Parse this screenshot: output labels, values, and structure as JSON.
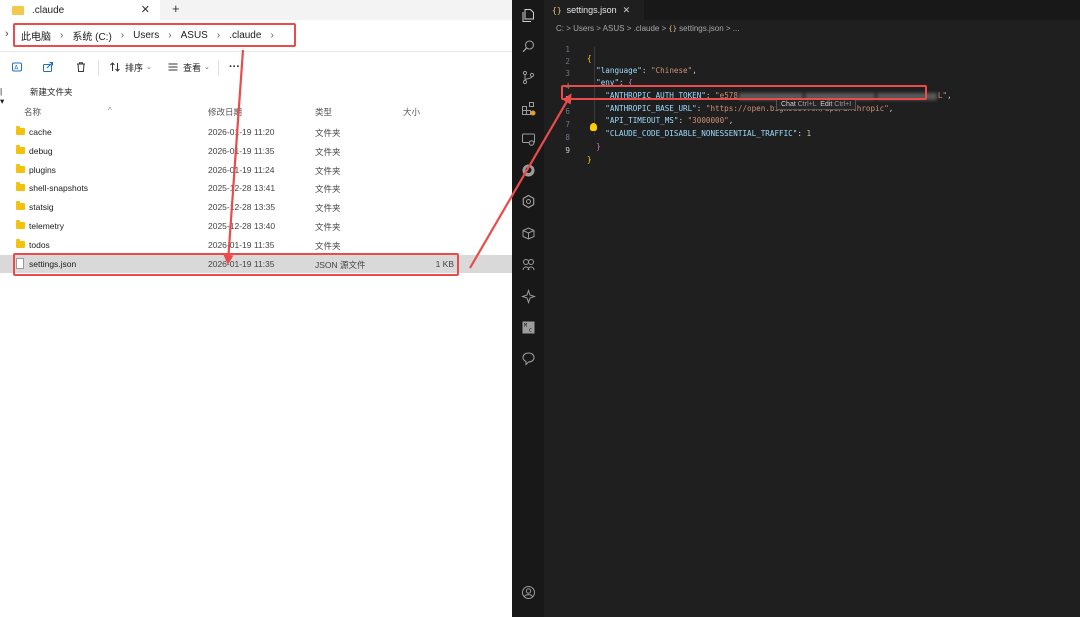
{
  "explorer": {
    "tab_title": ".claude",
    "tab_close": "✕",
    "new_tab": "+",
    "breadcrumb": [
      "此电脑",
      "系统 (C:)",
      "Users",
      "ASUS",
      ".claude"
    ],
    "toolbar": {
      "sort_label": "排序",
      "view_label": "查看",
      "more_label": "···"
    },
    "new_folder": "新建文件夹",
    "columns": {
      "name": "名称",
      "date": "修改日期",
      "type": "类型",
      "size": "大小"
    },
    "files": [
      {
        "name": "cache",
        "date": "2026-01-19 11:20",
        "type": "文件夹",
        "size": "",
        "kind": "folder"
      },
      {
        "name": "debug",
        "date": "2026-01-19 11:35",
        "type": "文件夹",
        "size": "",
        "kind": "folder"
      },
      {
        "name": "plugins",
        "date": "2026-01-19 11:24",
        "type": "文件夹",
        "size": "",
        "kind": "folder"
      },
      {
        "name": "shell-snapshots",
        "date": "2025-12-28 13:41",
        "type": "文件夹",
        "size": "",
        "kind": "folder"
      },
      {
        "name": "statsig",
        "date": "2025-12-28 13:35",
        "type": "文件夹",
        "size": "",
        "kind": "folder"
      },
      {
        "name": "telemetry",
        "date": "2025-12-28 13:40",
        "type": "文件夹",
        "size": "",
        "kind": "folder"
      },
      {
        "name": "todos",
        "date": "2026-01-19 11:35",
        "type": "文件夹",
        "size": "",
        "kind": "folder"
      },
      {
        "name": "settings.json",
        "date": "2026-01-19 11:35",
        "type": "JSON 源文件",
        "size": "1 KB",
        "kind": "file"
      }
    ]
  },
  "vscode": {
    "tab_title": "settings.json",
    "tab_close": "✕",
    "tab_icon": "{}",
    "breadcrumb_text": "C: > Users > ASUS > .claude > ",
    "breadcrumb_file": "settings.json > ...",
    "lines": [
      {
        "n": "1",
        "html_key": "l1"
      },
      {
        "n": "2",
        "html_key": "l2"
      },
      {
        "n": "3",
        "html_key": "l3"
      },
      {
        "n": "4",
        "html_key": "l4"
      },
      {
        "n": "5",
        "html_key": "l5"
      },
      {
        "n": "6",
        "html_key": "l6"
      },
      {
        "n": "7",
        "html_key": "l7"
      },
      {
        "n": "8",
        "html_key": "l8"
      },
      {
        "n": "9",
        "html_key": "l9"
      }
    ],
    "code": {
      "k_language": "\"language\"",
      "v_language": "\"Chinese\"",
      "k_env": "\"env\"",
      "k_token": "\"ANTHROPIC_AUTH_TOKEN\"",
      "v_token_start": "\"e578",
      "v_token_end": "L\"",
      "k_base_url": "\"ANTHROPIC_BASE_URL\"",
      "v_base_url": "\"https://open.bigmodel.cn/api/anthropic\"",
      "k_timeout": "\"API_TIMEOUT_MS\"",
      "v_timeout": "\"3000000\"",
      "k_nonessential": "\"CLAUDE_CODE_DISABLE_NONESSENTIAL_TRAFFIC\"",
      "v_nonessential": "1"
    },
    "inline_hint": {
      "chat": "Chat",
      "chat_kb": "Ctrl+L",
      "edit": "Edit",
      "edit_kb": "Ctrl+I"
    }
  },
  "colors": {
    "annotation_red": "#ea4b4b",
    "vscode_bg": "#1f1f1f",
    "json_key": "#9cdcfe",
    "json_string": "#ce9178",
    "folder_yellow": "#f4c20d"
  }
}
